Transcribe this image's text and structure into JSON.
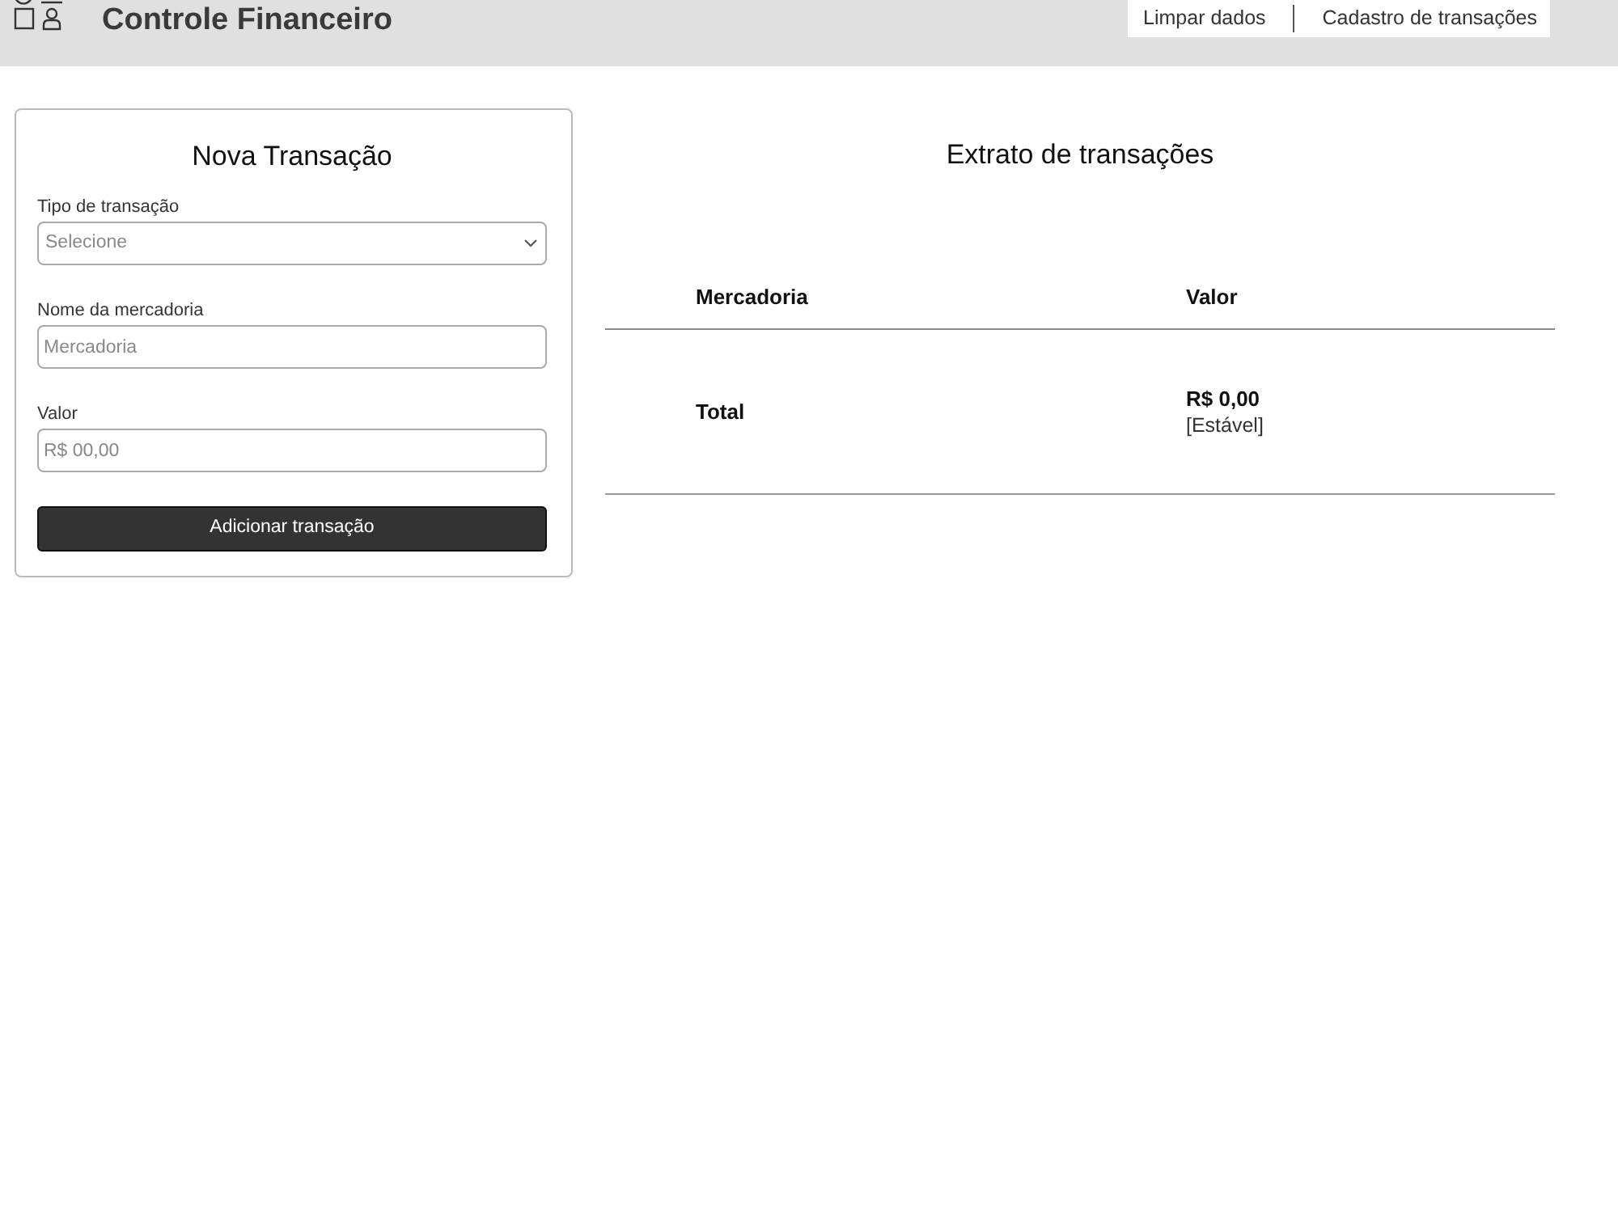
{
  "header": {
    "title": "Controle Financeiro",
    "nav": [
      "Limpar dados",
      "Cadastro de transações"
    ]
  },
  "form": {
    "title": "Nova Transação",
    "fields": [
      {
        "kind": "select",
        "label": "Tipo de transação",
        "placeholder": "Selecione"
      },
      {
        "kind": "text",
        "label": "Nome da mercadoria",
        "placeholder": "Mercadoria"
      },
      {
        "kind": "text",
        "label": "Valor",
        "placeholder": "R$ 00,00"
      }
    ],
    "submit": "Adicionar transação"
  },
  "statement": {
    "title": "Extrato de transações",
    "columns": [
      "Mercadoria",
      "Valor"
    ],
    "total": {
      "label": "Total",
      "amount": "R$ 0,00",
      "status": "[Estável]"
    }
  }
}
